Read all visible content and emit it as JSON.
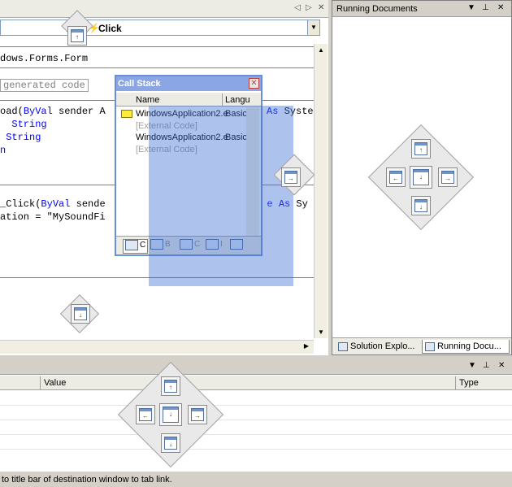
{
  "editor": {
    "event_combo": {
      "value": "Click"
    },
    "code_lines": [
      {
        "prefix": "dows.Forms.Form",
        "kw": "",
        "rest": ""
      },
      {
        "region": "generated code"
      },
      {
        "prefix": "oad(",
        "kw": "ByVal",
        "rest": " sender A",
        "kw2": "As",
        "rest2": " Syste"
      },
      {
        "prefix": "  ",
        "kw": "String",
        "rest": ""
      },
      {
        "prefix": " ",
        "kw": "String",
        "rest": ""
      },
      {
        "prefix": "",
        "kw": "n",
        "rest": ""
      },
      {
        "prefix": "_Click(",
        "kw": "ByVal",
        "rest": " sende",
        "kw2": "As",
        "rest2": " Sy",
        "mid": "l e"
      },
      {
        "prefix": "ation = \"MySoundFi",
        "kw": "",
        "rest": ""
      }
    ]
  },
  "running_documents": {
    "title": "Running Documents",
    "tabs": [
      {
        "label": "Solution Explo..."
      },
      {
        "label": "Running Docu..."
      }
    ]
  },
  "call_stack": {
    "title": "Call Stack",
    "columns": [
      "Name",
      "Langu"
    ],
    "rows": [
      {
        "name": "WindowsApplication2.e",
        "lang": "Basic"
      },
      {
        "name": "[External Code]",
        "lang": ""
      },
      {
        "name": "WindowsApplication2.e",
        "lang": "Basic"
      },
      {
        "name": "[External Code]",
        "lang": ""
      }
    ],
    "bottom_tabs": [
      {
        "label": "C"
      },
      {
        "label": "B"
      },
      {
        "label": "C"
      },
      {
        "label": "I"
      }
    ]
  },
  "bottom_panel": {
    "columns": [
      "Value",
      "Type"
    ]
  },
  "status_bar": {
    "text": "to title bar of destination window to tab link."
  },
  "colors": {
    "dock_preview": "#3c6ed2",
    "call_stack_title": "#8aa6e4",
    "keyword": "#0000ff"
  }
}
